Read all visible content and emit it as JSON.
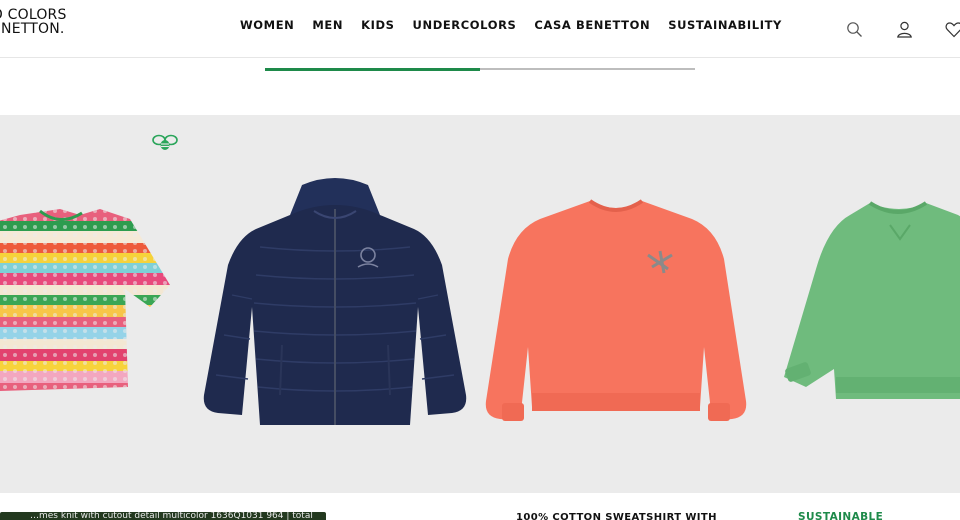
{
  "header": {
    "logo_line1": "D COLORS",
    "logo_line2": "ENETTON.",
    "nav": [
      "WOMEN",
      "MEN",
      "KIDS",
      "UNDERCOLORS",
      "CASA BENETTON",
      "SUSTAINABILITY"
    ],
    "icons": [
      "search-icon",
      "account-icon",
      "wishlist-heart-icon"
    ]
  },
  "carousel": {
    "progress": 0.5,
    "accent_color": "#1e8a4a",
    "track_color": "#bdbdbd"
  },
  "products": [
    {
      "name": "crochet-striped-top",
      "colors": [
        "#e83f6f",
        "#f7d33b",
        "#2a9a4a",
        "#f6f1e6"
      ]
    },
    {
      "name": "navy-puffer-jacket",
      "colors": [
        "#1f2a4e"
      ]
    },
    {
      "name": "coral-sweatshirt",
      "colors": [
        "#f7745e"
      ]
    },
    {
      "name": "green-sweatshirt",
      "colors": [
        "#6fbb7d"
      ]
    }
  ],
  "bottom": {
    "dark_bar_text": "…mes knit with cutout detail multicolor 1636Q1031 964 | total",
    "product_title": "100% COTTON SWEATSHIRT WITH",
    "badge": "SUSTAINABLE"
  }
}
